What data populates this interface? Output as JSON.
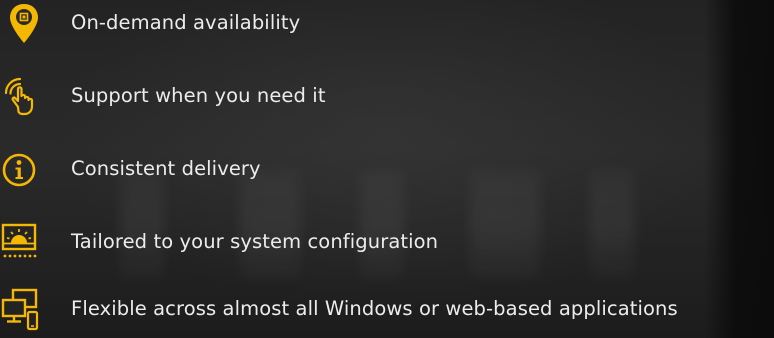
{
  "accent_color": "#f5b800",
  "features": [
    {
      "icon": "map-pin-icon",
      "label": "On-demand availability"
    },
    {
      "icon": "touch-hand-icon",
      "label": "Support when you need it"
    },
    {
      "icon": "info-icon",
      "label": "Consistent delivery"
    },
    {
      "icon": "presentation-screen-icon",
      "label": "Tailored to your system configuration"
    },
    {
      "icon": "multi-device-icon",
      "label": "Flexible across almost all Windows or web-based applications"
    }
  ]
}
